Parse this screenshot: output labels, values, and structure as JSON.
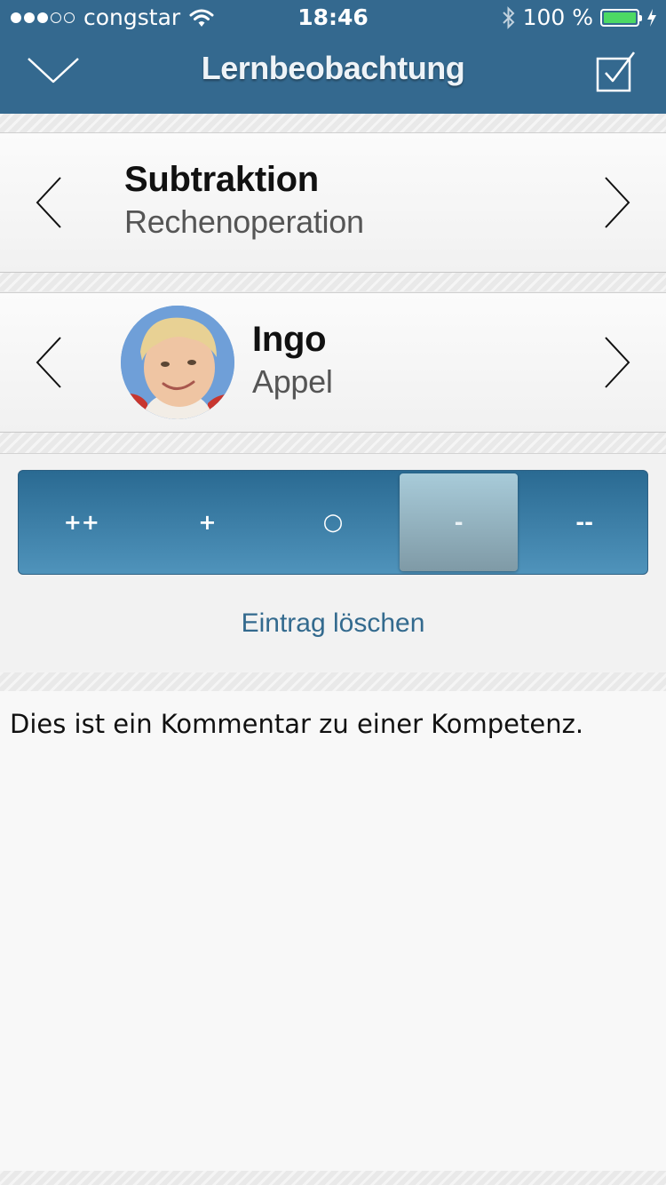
{
  "status_bar": {
    "signal_dots_filled": 3,
    "signal_dots_total": 5,
    "carrier": "congstar",
    "time": "18:46",
    "battery_text": "100 %",
    "battery_level": 1.0,
    "battery_color": "#4cd964"
  },
  "nav": {
    "title": "Lernbeobachtung",
    "close_icon": "chevron-down-icon",
    "done_icon": "checkbox-checked-icon",
    "bar_color": "#34698f"
  },
  "competence": {
    "title": "Subtraktion",
    "subtitle": "Rechenoperation"
  },
  "student": {
    "first_name": "Ingo",
    "last_name": "Appel"
  },
  "rating": {
    "options": [
      "++",
      "+",
      "○",
      "-",
      "--"
    ],
    "selected_index": 3
  },
  "delete_link": "Eintrag löschen",
  "comment": "Dies ist ein Kommentar zu einer Kompetenz.",
  "colors": {
    "accent": "#336a8e"
  }
}
